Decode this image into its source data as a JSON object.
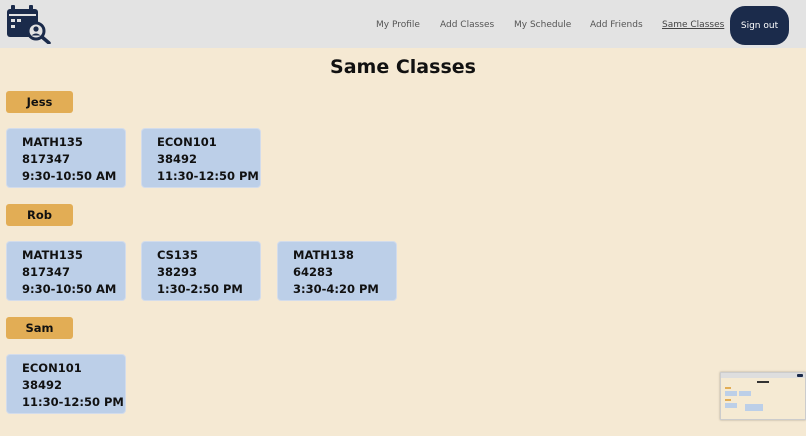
{
  "nav": {
    "logo_icon": "calendar-search-icon",
    "links": [
      {
        "label": "My Profile"
      },
      {
        "label": "Add Classes"
      },
      {
        "label": "My Schedule"
      },
      {
        "label": "Add Friends"
      },
      {
        "label": "Same Classes",
        "active": true
      }
    ],
    "signout_label": "Sign out"
  },
  "page": {
    "title": "Same Classes"
  },
  "friends": [
    {
      "name": "Jess",
      "classes": [
        {
          "course": "MATH135",
          "id": "817347",
          "time": "9:30-10:50 AM"
        },
        {
          "course": "ECON101",
          "id": "38492",
          "time": "11:30-12:50 PM"
        }
      ]
    },
    {
      "name": "Rob",
      "classes": [
        {
          "course": "MATH135",
          "id": "817347",
          "time": "9:30-10:50 AM"
        },
        {
          "course": "CS135",
          "id": "38293",
          "time": "1:30-2:50 PM"
        },
        {
          "course": "MATH138",
          "id": "64283",
          "time": "3:30-4:20 PM"
        }
      ]
    },
    {
      "name": "Sam",
      "classes": [
        {
          "course": "ECON101",
          "id": "38492",
          "time": "11:30-12:50 PM"
        }
      ]
    }
  ],
  "colors": {
    "background": "#f5e9d3",
    "navbar": "#e3e3e3",
    "signout": "#1b2b4b",
    "badge": "#e2ad55",
    "card": "#bccfe8"
  }
}
